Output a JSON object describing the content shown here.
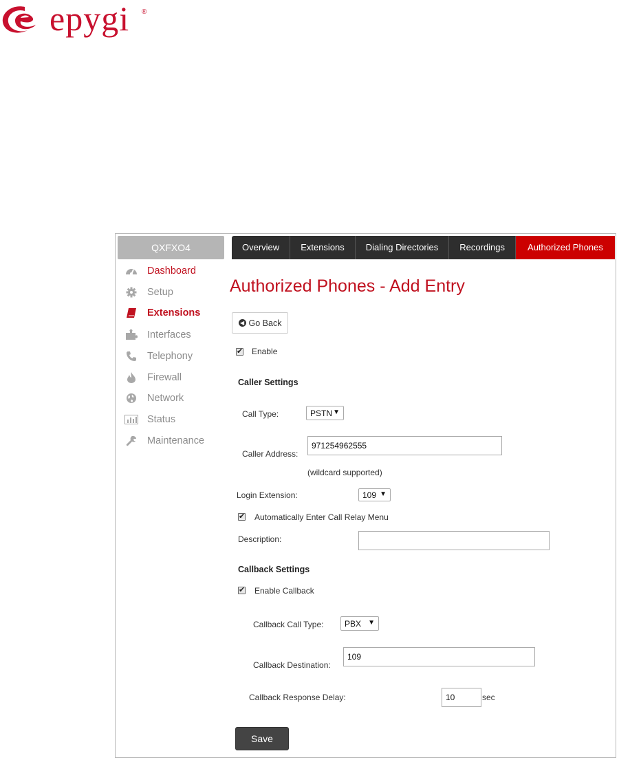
{
  "brand": {
    "name": "epygi",
    "registered": "®",
    "color": "#c8102e"
  },
  "device": {
    "name": "QXFXO4"
  },
  "sidebar": {
    "items": [
      {
        "label": "Dashboard",
        "icon": "dashboard-icon"
      },
      {
        "label": "Setup",
        "icon": "gear-icon"
      },
      {
        "label": "Extensions",
        "icon": "book-icon"
      },
      {
        "label": "Interfaces",
        "icon": "puzzle-icon"
      },
      {
        "label": "Telephony",
        "icon": "phone-icon"
      },
      {
        "label": "Firewall",
        "icon": "fire-icon"
      },
      {
        "label": "Network",
        "icon": "globe-icon"
      },
      {
        "label": "Status",
        "icon": "bar-chart-icon"
      },
      {
        "label": "Maintenance",
        "icon": "wrench-icon"
      }
    ]
  },
  "tabs": [
    {
      "label": "Overview"
    },
    {
      "label": "Extensions"
    },
    {
      "label": "Dialing Directories"
    },
    {
      "label": "Recordings"
    },
    {
      "label": "Authorized Phones",
      "active": true
    }
  ],
  "page": {
    "title": "Authorized Phones - Add Entry",
    "go_back_label": "Go Back",
    "enable_label": "Enable",
    "enable_checked": true
  },
  "caller_settings": {
    "header": "Caller Settings",
    "call_type_label": "Call Type:",
    "call_type_value": "PSTN",
    "caller_address_label": "Caller Address:",
    "caller_address_value": "971254962555",
    "wildcard_note": "(wildcard supported)",
    "login_extension_label": "Login Extension:",
    "login_extension_value": "109",
    "auto_relay_label": "Automatically Enter Call Relay Menu",
    "auto_relay_checked": true,
    "description_label": "Description:",
    "description_value": ""
  },
  "callback_settings": {
    "header": "Callback Settings",
    "enable_callback_label": "Enable Callback",
    "enable_callback_checked": true,
    "callback_call_type_label": "Callback Call Type:",
    "callback_call_type_value": "PBX",
    "callback_destination_label": "Callback Destination:",
    "callback_destination_value": "109",
    "response_delay_label": "Callback Response Delay:",
    "response_delay_value": "10",
    "response_delay_unit": "sec"
  },
  "save_label": "Save",
  "colors": {
    "accent_red": "#c0111f",
    "tab_bar": "#2e2e2e",
    "active_tab": "#cc0000",
    "sidebar_inactive": "#8c8c8c",
    "device_box": "#b5b5b5",
    "save_button": "#444444"
  }
}
